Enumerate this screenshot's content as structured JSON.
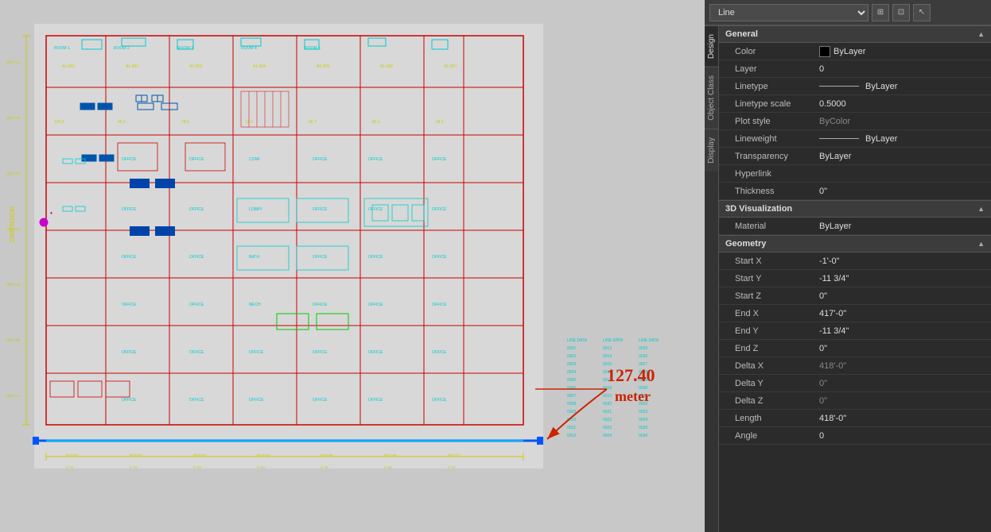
{
  "toolbar": {
    "entity_type": "Line",
    "icon1": "⊞",
    "icon2": "⊡",
    "icon3": "↖"
  },
  "side_tabs": [
    {
      "label": "Design",
      "active": true
    },
    {
      "label": "Object Class",
      "active": false
    },
    {
      "label": "Display",
      "active": false
    }
  ],
  "sections": {
    "general": {
      "title": "General",
      "properties": [
        {
          "label": "Color",
          "value": "ByLayer",
          "has_swatch": true
        },
        {
          "label": "Layer",
          "value": "0"
        },
        {
          "label": "Linetype",
          "value": "ByLayer",
          "has_line": true
        },
        {
          "label": "Linetype scale",
          "value": "0.5000"
        },
        {
          "label": "Plot style",
          "value": "ByColor",
          "muted": true
        },
        {
          "label": "Lineweight",
          "value": "ByLayer",
          "has_line": true
        },
        {
          "label": "Transparency",
          "value": "ByLayer"
        },
        {
          "label": "Hyperlink",
          "value": ""
        },
        {
          "label": "Thickness",
          "value": "0\""
        }
      ]
    },
    "visualization_3d": {
      "title": "3D Visualization",
      "properties": [
        {
          "label": "Material",
          "value": "ByLayer"
        }
      ]
    },
    "geometry": {
      "title": "Geometry",
      "properties": [
        {
          "label": "Start X",
          "value": "-1'-0\""
        },
        {
          "label": "Start Y",
          "value": "-11 3/4\""
        },
        {
          "label": "Start Z",
          "value": "0\""
        },
        {
          "label": "End X",
          "value": "417'-0\""
        },
        {
          "label": "End Y",
          "value": "-11 3/4\""
        },
        {
          "label": "End Z",
          "value": "0\""
        },
        {
          "label": "Delta X",
          "value": "418'-0\"",
          "muted": true
        },
        {
          "label": "Delta Y",
          "value": "0\"",
          "muted": true
        },
        {
          "label": "Delta Z",
          "value": "0\"",
          "muted": true
        },
        {
          "label": "Length",
          "value": "418'-0\""
        },
        {
          "label": "Angle",
          "value": "0"
        }
      ]
    }
  },
  "annotation": {
    "text": "127.40",
    "subtext": "meter"
  }
}
